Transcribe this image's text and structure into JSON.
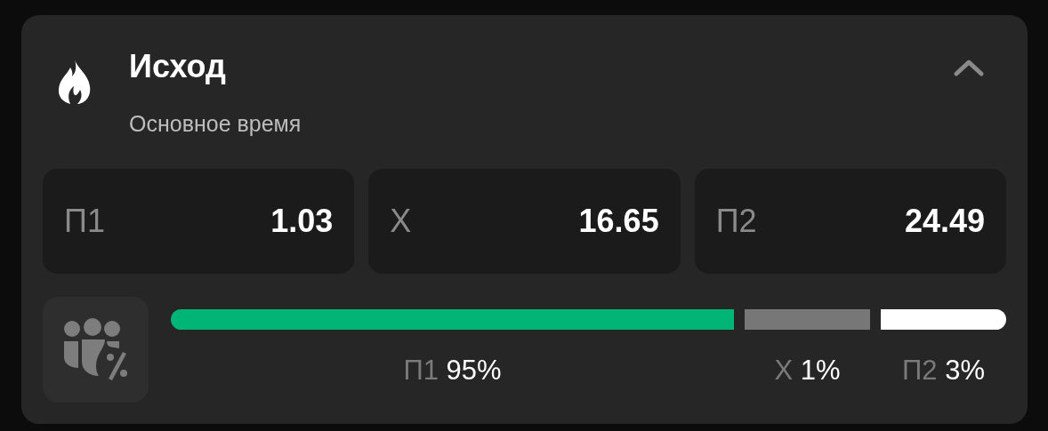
{
  "market": {
    "title": "Исход",
    "subtitle": "Основное время",
    "expanded": true
  },
  "odds": [
    {
      "label": "П1",
      "value": "1.03"
    },
    {
      "label": "Х",
      "value": "16.65"
    },
    {
      "label": "П2",
      "value": "24.49"
    }
  ],
  "distribution": [
    {
      "label": "П1",
      "percent": "95%",
      "color": "#00b576"
    },
    {
      "label": "Х",
      "percent": "1%",
      "color": "#777777"
    },
    {
      "label": "П2",
      "percent": "3%",
      "color": "#ffffff"
    }
  ]
}
